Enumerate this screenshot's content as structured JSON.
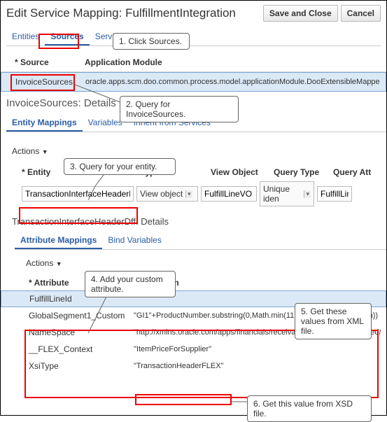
{
  "header": {
    "title": "Edit Service Mapping: FulfillmentIntegration",
    "save_close": "Save and Close",
    "cancel": "Cancel"
  },
  "top_tabs": {
    "entities": "Entities",
    "sources": "Sources",
    "services": "Services"
  },
  "callouts": {
    "c1": "1. Click Sources.",
    "c2": "2. Query for InvoiceSources.",
    "c3": "3. Query for your entity.",
    "c4": "4. Add your custom attribute.",
    "c5": "5. Get these values from XML file.",
    "c6": "6. Get this value from XSD file."
  },
  "source_table": {
    "h1": "Source",
    "h2": "Application Module",
    "row1_source": "InvoiceSources",
    "row1_appmod": "oracle.apps.scm.doo.common.process.model.applicationModule.DooExtensibleMapperAM"
  },
  "details_title": "InvoiceSources: Details",
  "detail_tabs": {
    "entity_mappings": "Entity Mappings",
    "variables": "Variables",
    "inherit": "Inherit from Services"
  },
  "actions_label": "Actions",
  "entity_grid": {
    "h_entity": "Entity",
    "h_type": "Type",
    "h_viewobj": "View Object",
    "h_qtype": "Query Type",
    "h_qattr": "Query Att",
    "row": {
      "entity": "TransactionInterfaceHeaderDff",
      "type": "View object",
      "viewobj": "FulfillLineVO",
      "qtype": "Unique iden",
      "qattr": "FulfillLin"
    }
  },
  "entity_details_title": "TransactionInterfaceHeaderDff: Details",
  "attr_tabs": {
    "attr_mappings": "Attribute Mappings",
    "bind_vars": "Bind Variables"
  },
  "attr_grid": {
    "h_attr": "Attribute",
    "h_expr": "Expression",
    "rows": [
      {
        "attr": "FulfillLineId",
        "expr": ""
      },
      {
        "attr": "GlobalSegment1_Custom",
        "expr": "\"GI1\"+ProductNumber.substring(0,Math.min(11,ProductNumber.length))"
      },
      {
        "attr": "NameSpace",
        "expr": "\"http://xmlns.oracle.com/apps/financials/receivables/transactions/shared/mode"
      },
      {
        "attr": "__FLEX_Context",
        "expr": "\"ItemPriceForSupplier\""
      },
      {
        "attr": "XsiType",
        "expr": "\"TransactionHeaderFLEX\""
      }
    ]
  }
}
